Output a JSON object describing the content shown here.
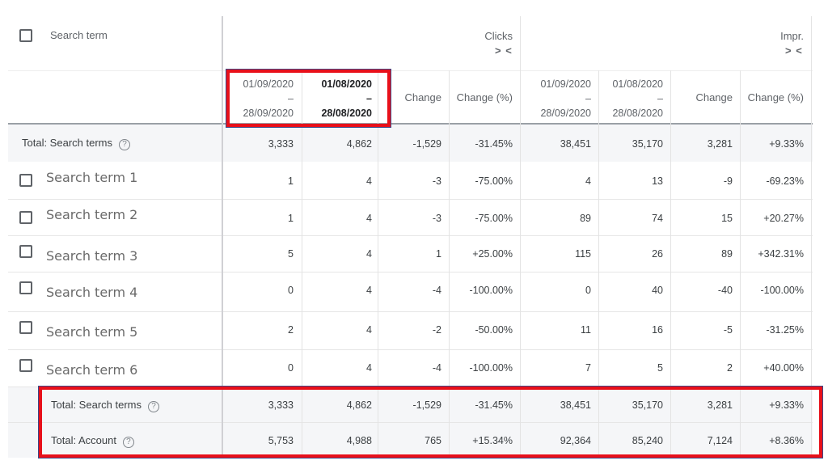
{
  "header": {
    "search_term_label": "Search term",
    "groups": [
      {
        "title": "Clicks",
        "collapse_icon": "> <"
      },
      {
        "title": "Impr.",
        "collapse_icon": "> <"
      }
    ],
    "columns": [
      {
        "start": "01/09/2020",
        "sep": "–",
        "end": "28/09/2020"
      },
      {
        "start": "01/08/2020",
        "sep": "–",
        "end": "28/08/2020"
      },
      {
        "label": "Change"
      },
      {
        "label": "Change (%)"
      },
      {
        "start": "01/09/2020",
        "sep": "–",
        "end": "28/09/2020"
      },
      {
        "start": "01/08/2020",
        "sep": "–",
        "end": "28/08/2020"
      },
      {
        "label": "Change"
      },
      {
        "label": "Change (%)"
      }
    ]
  },
  "top_total": {
    "label": "Total: Search terms",
    "help_icon": "?",
    "values": [
      "3,333",
      "4,862",
      "-1,529",
      "-31.45%",
      "38,451",
      "35,170",
      "3,281",
      "+9.33%"
    ]
  },
  "rows": [
    {
      "term": "Search term 1",
      "values": [
        "1",
        "4",
        "-3",
        "-75.00%",
        "4",
        "13",
        "-9",
        "-69.23%"
      ]
    },
    {
      "term": "Search term 2",
      "values": [
        "1",
        "4",
        "-3",
        "-75.00%",
        "89",
        "74",
        "15",
        "+20.27%"
      ]
    },
    {
      "term": "Search term 3",
      "values": [
        "5",
        "4",
        "1",
        "+25.00%",
        "115",
        "26",
        "89",
        "+342.31%"
      ]
    },
    {
      "term": "Search term 4",
      "values": [
        "0",
        "4",
        "-4",
        "-100.00%",
        "0",
        "40",
        "-40",
        "-100.00%"
      ]
    },
    {
      "term": "Search term 5",
      "values": [
        "2",
        "4",
        "-2",
        "-50.00%",
        "11",
        "16",
        "-5",
        "-31.25%"
      ]
    },
    {
      "term": "Search term 6",
      "values": [
        "0",
        "4",
        "-4",
        "-100.00%",
        "7",
        "5",
        "2",
        "+40.00%"
      ]
    }
  ],
  "footer_totals": [
    {
      "label": "Total: Search terms",
      "help_icon": "?",
      "values": [
        "3,333",
        "4,862",
        "-1,529",
        "-31.45%",
        "38,451",
        "35,170",
        "3,281",
        "+9.33%"
      ]
    },
    {
      "label": "Total: Account",
      "help_icon": "?",
      "values": [
        "5,753",
        "4,988",
        "765",
        "+15.34%",
        "92,364",
        "85,240",
        "7,124",
        "+8.36%"
      ]
    }
  ],
  "highlight_color": "#e8101a"
}
